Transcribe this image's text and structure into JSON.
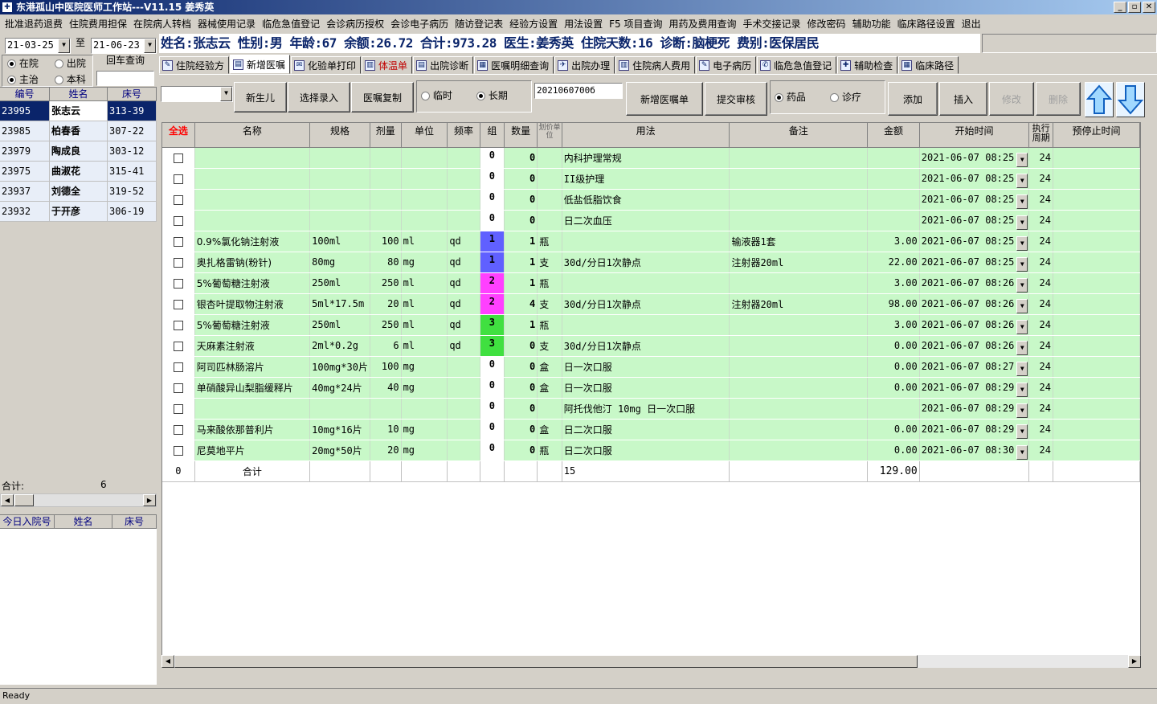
{
  "window": {
    "title": "东港孤山中医院医师工作站---V11.15  姜秀英",
    "controls": [
      "_",
      "▫",
      "✕"
    ]
  },
  "menu": [
    "批准退药退费",
    "住院费用担保",
    "在院病人转档",
    "器械使用记录",
    "临危急值登记",
    "会诊病历授权",
    "会诊电子病历",
    "随访登记表",
    "经验方设置",
    "用法设置",
    "F5 项目查询",
    "用药及费用查询",
    "手术交接记录",
    "修改密码",
    "辅助功能",
    "临床路径设置",
    "退出"
  ],
  "filter": {
    "date_from": "21-03-25",
    "to_label": "至",
    "date_to": "21-06-23",
    "return_query": "回车查询",
    "radio_in": "在院",
    "radio_out": "出院",
    "radio_main": "主治",
    "radio_dept": "本科",
    "search_value": ""
  },
  "patients": {
    "headers": [
      "编号",
      "姓名",
      "床号"
    ],
    "rows": [
      {
        "id": "23995",
        "name": "张志云",
        "bed": "313-39"
      },
      {
        "id": "23985",
        "name": "柏春香",
        "bed": "307-22"
      },
      {
        "id": "23979",
        "name": "陶成良",
        "bed": "303-12"
      },
      {
        "id": "23975",
        "name": "曲淑花",
        "bed": "315-41"
      },
      {
        "id": "23937",
        "name": "刘德全",
        "bed": "319-52"
      },
      {
        "id": "23932",
        "name": "于开彦",
        "bed": "306-19"
      }
    ],
    "total_label": "合计:",
    "total_value": "6"
  },
  "today_admit": {
    "headers": [
      "今日入院号",
      "姓名",
      "床号"
    ]
  },
  "patient_info": "姓名:张志云 性别:男 年龄:67 余额:26.72 合计:973.28 医生:姜秀英 住院天数:16 诊断:脑梗死 费别:医保居民",
  "tabs": [
    {
      "label": "住院经验方"
    },
    {
      "label": "新增医嘱"
    },
    {
      "label": "化验单打印"
    },
    {
      "label": "体温单"
    },
    {
      "label": "出院诊断"
    },
    {
      "label": "医嘱明细查询"
    },
    {
      "label": "出院办理"
    },
    {
      "label": "住院病人费用"
    },
    {
      "label": "电子病历"
    },
    {
      "label": "临危急值登记"
    },
    {
      "label": "辅助检查"
    },
    {
      "label": "临床路径"
    }
  ],
  "toolbar": {
    "newborn": "新生儿",
    "select_entry": "选择录入",
    "copy_order": "医嘱复制",
    "temp": "临时",
    "long": "长期",
    "order_no": "2021060700б",
    "new_order_sheet": "新增医嘱单",
    "submit_review": "提交审核",
    "drug": "药品",
    "treatment": "诊疗",
    "add": "添加",
    "insert": "插入",
    "modify": "修改",
    "delete": "删除"
  },
  "orders": {
    "headers": {
      "select_all": "全选",
      "name": "名称",
      "spec": "规格",
      "dose": "剂量",
      "unit": "单位",
      "freq": "频率",
      "group": "组",
      "qty": "数量",
      "price_unit": "划价单位",
      "usage": "用法",
      "note": "备注",
      "amount": "金额",
      "start": "开始时间",
      "period": "执行周期",
      "stop": "预停止时间"
    },
    "rows": [
      {
        "name": "",
        "spec": "",
        "dose": "",
        "unit": "",
        "freq": "",
        "group": "0",
        "qty": "0",
        "pu": "",
        "usage": "内科护理常规",
        "note": "",
        "amount": "",
        "start": "2021-06-07 08:25",
        "period": "24"
      },
      {
        "name": "",
        "spec": "",
        "dose": "",
        "unit": "",
        "freq": "",
        "group": "0",
        "qty": "0",
        "pu": "",
        "usage": "II级护理",
        "note": "",
        "amount": "",
        "start": "2021-06-07 08:25",
        "period": "24"
      },
      {
        "name": "",
        "spec": "",
        "dose": "",
        "unit": "",
        "freq": "",
        "group": "0",
        "qty": "0",
        "pu": "",
        "usage": "低盐低脂饮食",
        "note": "",
        "amount": "",
        "start": "2021-06-07 08:25",
        "period": "24"
      },
      {
        "name": "",
        "spec": "",
        "dose": "",
        "unit": "",
        "freq": "",
        "group": "0",
        "qty": "0",
        "pu": "",
        "usage": "日二次血压",
        "note": "",
        "amount": "",
        "start": "2021-06-07 08:25",
        "period": "24"
      },
      {
        "name": "0.9%氯化钠注射液",
        "spec": "100ml",
        "dose": "100",
        "unit": "ml",
        "freq": "qd",
        "group": "1",
        "qty": "1",
        "pu": "瓶",
        "usage": "",
        "note": "输液器1套",
        "amount": "3.00",
        "start": "2021-06-07 08:25",
        "period": "24"
      },
      {
        "name": "奥扎格雷钠(粉针)",
        "spec": "80mg",
        "dose": "80",
        "unit": "mg",
        "freq": "qd",
        "group": "1",
        "qty": "1",
        "pu": "支",
        "usage": "30d/分日1次静点",
        "note": "注射器20ml",
        "amount": "22.00",
        "start": "2021-06-07 08:25",
        "period": "24"
      },
      {
        "name": "5%葡萄糖注射液",
        "spec": "250ml",
        "dose": "250",
        "unit": "ml",
        "freq": "qd",
        "group": "2",
        "qty": "1",
        "pu": "瓶",
        "usage": "",
        "note": "",
        "amount": "3.00",
        "start": "2021-06-07 08:26",
        "period": "24"
      },
      {
        "name": "银杏叶提取物注射液",
        "spec": "5ml*17.5m",
        "dose": "20",
        "unit": "ml",
        "freq": "qd",
        "group": "2",
        "qty": "4",
        "pu": "支",
        "usage": "30d/分日1次静点",
        "note": "注射器20ml",
        "amount": "98.00",
        "start": "2021-06-07 08:26",
        "period": "24"
      },
      {
        "name": "5%葡萄糖注射液",
        "spec": "250ml",
        "dose": "250",
        "unit": "ml",
        "freq": "qd",
        "group": "3",
        "qty": "1",
        "pu": "瓶",
        "usage": "",
        "note": "",
        "amount": "3.00",
        "start": "2021-06-07 08:26",
        "period": "24"
      },
      {
        "name": "天麻素注射液",
        "spec": "2ml*0.2g",
        "dose": "6",
        "unit": "ml",
        "freq": "qd",
        "group": "3",
        "qty": "0",
        "pu": "支",
        "usage": "30d/分日1次静点",
        "note": "",
        "amount": "0.00",
        "start": "2021-06-07 08:26",
        "period": "24"
      },
      {
        "name": "阿司匹林肠溶片",
        "spec": "100mg*30片",
        "dose": "100",
        "unit": "mg",
        "freq": "",
        "group": "0",
        "qty": "0",
        "pu": "盒",
        "usage": "日一次口服",
        "note": "",
        "amount": "0.00",
        "start": "2021-06-07 08:27",
        "period": "24"
      },
      {
        "name": "单硝酸异山梨脂缓释片",
        "spec": "40mg*24片",
        "dose": "40",
        "unit": "mg",
        "freq": "",
        "group": "0",
        "qty": "0",
        "pu": "盒",
        "usage": "日一次口服",
        "note": "",
        "amount": "0.00",
        "start": "2021-06-07 08:29",
        "period": "24"
      },
      {
        "name": "",
        "spec": "",
        "dose": "",
        "unit": "",
        "freq": "",
        "group": "0",
        "qty": "0",
        "pu": "",
        "usage": "阿托伐他汀 10mg 日一次口服",
        "note": "",
        "amount": "",
        "start": "2021-06-07 08:29",
        "period": "24"
      },
      {
        "name": "马来酸依那普利片",
        "spec": "10mg*16片",
        "dose": "10",
        "unit": "mg",
        "freq": "",
        "group": "0",
        "qty": "0",
        "pu": "盒",
        "usage": "日二次口服",
        "note": "",
        "amount": "0.00",
        "start": "2021-06-07 08:29",
        "period": "24"
      },
      {
        "name": "尼莫地平片",
        "spec": "20mg*50片",
        "dose": "20",
        "unit": "mg",
        "freq": "",
        "group": "0",
        "qty": "0",
        "pu": "瓶",
        "usage": "日二次口服",
        "note": "",
        "amount": "0.00",
        "start": "2021-06-07 08:30",
        "period": "24"
      }
    ],
    "total": {
      "count": "0",
      "label": "合计",
      "usage": "15",
      "amount": "129.00"
    }
  },
  "group_colors": {
    "1": "#6060ff",
    "2": "#ff40ff",
    "3": "#40e040"
  },
  "status": "Ready"
}
